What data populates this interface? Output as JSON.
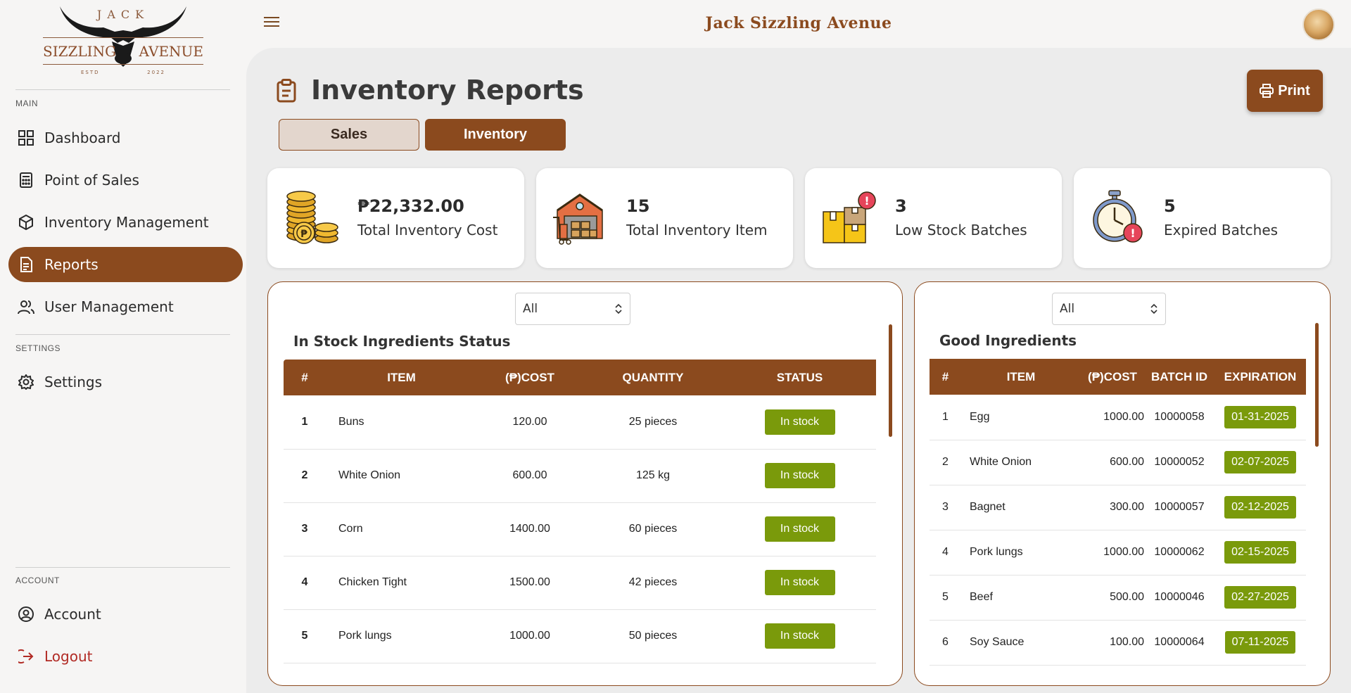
{
  "logo": {
    "top_text": "JACK",
    "left_text": "SIZZLING",
    "right_text": "AVENUE",
    "estd": "ESTD",
    "year": "2022"
  },
  "app_title": "Jack Sizzling Avenue",
  "sidebar": {
    "main_label": "MAIN",
    "settings_label": "SETTINGS",
    "account_label": "ACCOUNT",
    "items": [
      {
        "label": "Dashboard",
        "icon": "grid-icon"
      },
      {
        "label": "Point of Sales",
        "icon": "calculator-icon"
      },
      {
        "label": "Inventory Management",
        "icon": "cube-icon"
      },
      {
        "label": "Reports",
        "icon": "document-icon",
        "active": true
      },
      {
        "label": "User Management",
        "icon": "users-icon"
      }
    ],
    "settings": {
      "label": "Settings",
      "icon": "gear-icon"
    },
    "account": {
      "label": "Account",
      "icon": "user-circle-icon"
    },
    "logout": {
      "label": "Logout",
      "icon": "logout-icon"
    }
  },
  "page": {
    "title": "Inventory Reports",
    "print_label": "Print",
    "tabs": [
      {
        "label": "Sales"
      },
      {
        "label": "Inventory",
        "active": true
      }
    ]
  },
  "stats": [
    {
      "value": "₱22,332.00",
      "label": "Total Inventory Cost",
      "icon": "coins-icon"
    },
    {
      "value": "15",
      "label": "Total Inventory Item",
      "icon": "warehouse-icon"
    },
    {
      "value": "3",
      "label": "Low Stock Batches",
      "icon": "boxes-alert-icon"
    },
    {
      "value": "5",
      "label": "Expired Batches",
      "icon": "stopwatch-alert-icon"
    }
  ],
  "in_stock": {
    "filter": "All",
    "title": "In Stock Ingredients Status",
    "columns": [
      "#",
      "ITEM",
      "(₱)COST",
      "QUANTITY",
      "STATUS"
    ],
    "rows": [
      {
        "num": "1",
        "item": "Buns",
        "cost": "120.00",
        "qty": "25 pieces",
        "status": "In stock"
      },
      {
        "num": "2",
        "item": "White Onion",
        "cost": "600.00",
        "qty": "125 kg",
        "status": "In stock"
      },
      {
        "num": "3",
        "item": "Corn",
        "cost": "1400.00",
        "qty": "60 pieces",
        "status": "In stock"
      },
      {
        "num": "4",
        "item": "Chicken Tight",
        "cost": "1500.00",
        "qty": "42 pieces",
        "status": "In stock"
      },
      {
        "num": "5",
        "item": "Pork lungs",
        "cost": "1000.00",
        "qty": "50 pieces",
        "status": "In stock"
      }
    ]
  },
  "good": {
    "filter": "All",
    "title": "Good Ingredients",
    "columns": [
      "#",
      "ITEM",
      "(₱)COST",
      "BATCH ID",
      "EXPIRATION"
    ],
    "rows": [
      {
        "num": "1",
        "item": "Egg",
        "cost": "1000.00",
        "batch": "10000058",
        "exp": "01-31-2025"
      },
      {
        "num": "2",
        "item": "White Onion",
        "cost": "600.00",
        "batch": "10000052",
        "exp": "02-07-2025"
      },
      {
        "num": "3",
        "item": "Bagnet",
        "cost": "300.00",
        "batch": "10000057",
        "exp": "02-12-2025"
      },
      {
        "num": "4",
        "item": "Pork lungs",
        "cost": "1000.00",
        "batch": "10000062",
        "exp": "02-15-2025"
      },
      {
        "num": "5",
        "item": "Beef",
        "cost": "500.00",
        "batch": "10000046",
        "exp": "02-27-2025"
      },
      {
        "num": "6",
        "item": "Soy Sauce",
        "cost": "100.00",
        "batch": "10000064",
        "exp": "07-11-2025"
      }
    ]
  },
  "colors": {
    "brand": "#8b4a1e",
    "status_green": "#7a9a0b",
    "logout": "#b12a24"
  }
}
